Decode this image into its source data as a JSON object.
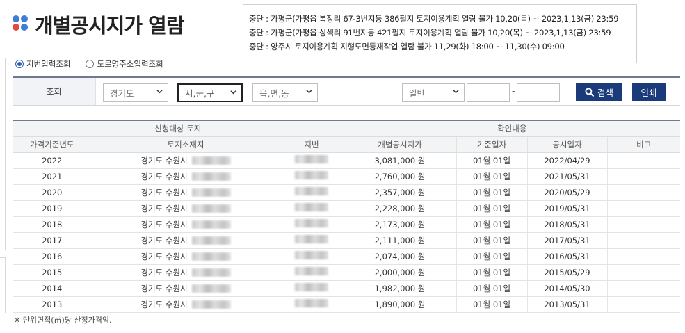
{
  "header": {
    "title": "개별공시지가 열람"
  },
  "notices": [
    "중단 : 가평군(가평읍 복장리 67-3번지등 386필지 토지이용계획 열람 불가 10,20(목) ~ 2023,1,13(금) 23:59",
    "중단 : 가평군(가평읍 상색리 91번지등 421필지 토지이용계획 열람 불가 10,20(목) ~ 2023,1,13(금) 23:59",
    "중단 : 양주시 토지이용계획 지형도면등재작업 열람 불가 11,29(화) 18:00 ~ 11,30(수) 09:00"
  ],
  "search_mode": {
    "options": [
      "지번입력조회",
      "도로명주소입력조회"
    ],
    "selected": "지번입력조회"
  },
  "search": {
    "label": "조회",
    "province": "경기도",
    "city_placeholder": "시,군,구",
    "town_placeholder": "읍,면,동",
    "lot_type": "일반",
    "dash": "-",
    "search_button": "검색",
    "print_button": "인쇄"
  },
  "table": {
    "group_headers": [
      "신청대상 토지",
      "확인내용"
    ],
    "columns": [
      "가격기준년도",
      "토지소재지",
      "지번",
      "개별공시지가",
      "기준일자",
      "공시일자",
      "비고"
    ],
    "rows": [
      {
        "year": "2022",
        "location": "경기도 수원시",
        "price": "3,081,000 원",
        "base_date": "01월 01일",
        "pub_date": "2022/04/29",
        "note": ""
      },
      {
        "year": "2021",
        "location": "경기도 수원시",
        "price": "2,760,000 원",
        "base_date": "01월 01일",
        "pub_date": "2021/05/31",
        "note": ""
      },
      {
        "year": "2020",
        "location": "경기도 수원시",
        "price": "2,357,000 원",
        "base_date": "01월 01일",
        "pub_date": "2020/05/29",
        "note": ""
      },
      {
        "year": "2019",
        "location": "경기도 수원시",
        "price": "2,228,000 원",
        "base_date": "01월 01일",
        "pub_date": "2019/05/31",
        "note": ""
      },
      {
        "year": "2018",
        "location": "경기도 수원시",
        "price": "2,173,000 원",
        "base_date": "01월 01일",
        "pub_date": "2018/05/31",
        "note": ""
      },
      {
        "year": "2017",
        "location": "경기도 수원시",
        "price": "2,111,000 원",
        "base_date": "01월 01일",
        "pub_date": "2017/05/31",
        "note": ""
      },
      {
        "year": "2016",
        "location": "경기도 수원시",
        "price": "2,074,000 원",
        "base_date": "01월 01일",
        "pub_date": "2016/05/31",
        "note": ""
      },
      {
        "year": "2015",
        "location": "경기도 수원시",
        "price": "2,000,000 원",
        "base_date": "01월 01일",
        "pub_date": "2015/05/29",
        "note": ""
      },
      {
        "year": "2014",
        "location": "경기도 수원시",
        "price": "1,982,000 원",
        "base_date": "01월 01일",
        "pub_date": "2014/05/30",
        "note": ""
      },
      {
        "year": "2013",
        "location": "경기도 수원시",
        "price": "1,890,000 원",
        "base_date": "01월 01일",
        "pub_date": "2013/05/31",
        "note": ""
      }
    ]
  },
  "footnote": "※ 단위면적(㎡)당 산정가격임.",
  "colors": {
    "button": "#1b3a7a",
    "header_bar": "#6f7b8c",
    "logo_blue": "#3b7dd8",
    "logo_red": "#e04a3f"
  }
}
